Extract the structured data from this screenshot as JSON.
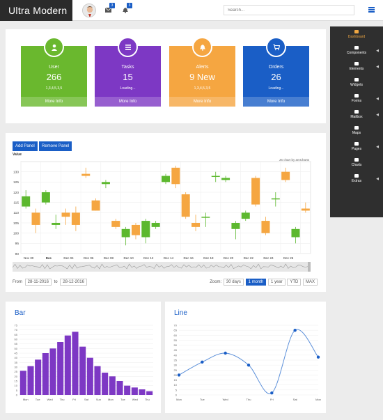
{
  "header": {
    "brand": "Ultra Modern",
    "mail_badge": "3",
    "bell_badge": "3",
    "search_placeholder": "Search..."
  },
  "sidebar": {
    "items": [
      {
        "label": "Dashboard",
        "icon": "home-icon",
        "active": true
      },
      {
        "label": "Components",
        "icon": "cogs-icon"
      },
      {
        "label": "Elements",
        "icon": "book-icon"
      },
      {
        "label": "Widgets",
        "icon": "grid-icon"
      },
      {
        "label": "Forms",
        "icon": "edit-icon"
      },
      {
        "label": "Mailbox",
        "icon": "mail-icon"
      },
      {
        "label": "Maps",
        "icon": "location-arrow-icon"
      },
      {
        "label": "Pages",
        "icon": "file-icon"
      },
      {
        "label": "Charts",
        "icon": "chart-icon"
      },
      {
        "label": "Extras",
        "icon": "list-icon"
      }
    ]
  },
  "stats": [
    {
      "label": "User",
      "value": "266",
      "sub": "1,3,4,5,3,5",
      "more": "More Info",
      "color": "#6ab82e",
      "icon": "user-icon"
    },
    {
      "label": "Tasks",
      "value": "15",
      "sub": "Loading...",
      "more": "More Info",
      "color": "#7d38c4",
      "icon": "list-icon"
    },
    {
      "label": "Alerts",
      "value": "9 New",
      "sub": "1,3,4,5,3,5",
      "more": "More Info",
      "color": "#f5a641",
      "icon": "bell-icon"
    },
    {
      "label": "Orders",
      "value": "26",
      "sub": "Loading...",
      "more": "More Info",
      "color": "#1a5ec6",
      "icon": "cart-icon"
    }
  ],
  "candle_panel": {
    "add_label": "Add Panel",
    "remove_label": "Remove Panel",
    "from_label": "From",
    "to_label": "to",
    "from_date": "28-11-2016",
    "to_date": "28-12-2016",
    "zoom_label": "Zoom:",
    "zoom_options": [
      "30 days",
      "1 month",
      "1 year",
      "YTD",
      "MAX"
    ],
    "zoom_selected": "1 month"
  },
  "chart_data": [
    {
      "type": "candlestick",
      "ylabel": "Value",
      "credit": "JS chart by amCharts",
      "ylim": [
        90,
        135
      ],
      "yticks": [
        90,
        95,
        100,
        105,
        110,
        115,
        120,
        125,
        130
      ],
      "xticks": [
        "Nov 30",
        "Dec",
        "Dec 04",
        "Dec 06",
        "Dec 08",
        "Dec 10",
        "Dec 12",
        "Dec 14",
        "Dec 16",
        "Dec 18",
        "Dec 20",
        "Dec 22",
        "Dec 24",
        "Dec 26"
      ],
      "up_color": "#5cb82e",
      "down_color": "#f5a641",
      "candles": [
        {
          "open": 113,
          "close": 118,
          "high": 121,
          "low": 112
        },
        {
          "open": 110,
          "close": 104,
          "high": 112,
          "low": 100
        },
        {
          "open": 115,
          "close": 120,
          "high": 121,
          "low": 114
        },
        {
          "open": 104,
          "close": 105,
          "high": 109,
          "low": 102
        },
        {
          "open": 110,
          "close": 108,
          "high": 112,
          "low": 104
        },
        {
          "open": 110,
          "close": 104,
          "high": 113,
          "low": 101
        },
        {
          "open": 129,
          "close": 128,
          "high": 132,
          "low": 127
        },
        {
          "open": 116,
          "close": 111,
          "high": 117,
          "low": 111
        },
        {
          "open": 124,
          "close": 125,
          "high": 126,
          "low": 122
        },
        {
          "open": 106,
          "close": 103,
          "high": 107,
          "low": 102
        },
        {
          "open": 98,
          "close": 102,
          "high": 103,
          "low": 94
        },
        {
          "open": 104,
          "close": 99,
          "high": 105,
          "low": 97
        },
        {
          "open": 98,
          "close": 106,
          "high": 107,
          "low": 95
        },
        {
          "open": 103,
          "close": 105,
          "high": 106,
          "low": 102
        },
        {
          "open": 125,
          "close": 128,
          "high": 129,
          "low": 124
        },
        {
          "open": 132,
          "close": 124,
          "high": 133,
          "low": 122
        },
        {
          "open": 119,
          "close": 108,
          "high": 120,
          "low": 107
        },
        {
          "open": 105,
          "close": 103,
          "high": 109,
          "low": 101
        },
        {
          "open": 108,
          "close": 108,
          "high": 110,
          "low": 103
        },
        {
          "open": 128,
          "close": 128,
          "high": 130,
          "low": 125
        },
        {
          "open": 126,
          "close": 127,
          "high": 128,
          "low": 125
        },
        {
          "open": 102,
          "close": 105,
          "high": 106,
          "low": 97
        },
        {
          "open": 107,
          "close": 110,
          "high": 111,
          "low": 106
        },
        {
          "open": 127,
          "close": 114,
          "high": 128,
          "low": 113
        },
        {
          "open": 106,
          "close": 100,
          "high": 108,
          "low": 99
        },
        {
          "open": 117,
          "close": 117,
          "high": 120,
          "low": 113
        },
        {
          "open": 130,
          "close": 126,
          "high": 132,
          "low": 125
        },
        {
          "open": 98,
          "close": 102,
          "high": 103,
          "low": 95
        },
        {
          "open": 112,
          "close": 111,
          "high": 115,
          "low": 110
        }
      ]
    },
    {
      "type": "bar",
      "title": "Bar",
      "color": "#7d38c4",
      "ylim": [
        0,
        75
      ],
      "yticks": [
        0,
        5,
        10,
        15,
        20,
        25,
        30,
        35,
        40,
        45,
        50,
        55,
        60,
        65,
        70,
        75
      ],
      "xticks": [
        "Mon",
        "Tue",
        "Wed",
        "Thu",
        "Fri",
        "Sat",
        "Sun",
        "Mon",
        "Tue",
        "Wed",
        "Thu"
      ],
      "values": [
        26,
        31,
        38,
        45,
        50,
        57,
        64,
        68,
        52,
        40,
        31,
        24,
        20,
        15,
        10,
        8,
        6,
        4
      ]
    },
    {
      "type": "line",
      "title": "Line",
      "color": "#1a5ec6",
      "ylim": [
        0,
        70
      ],
      "yticks": [
        0,
        5,
        10,
        15,
        20,
        25,
        30,
        35,
        40,
        45,
        50,
        55,
        60,
        65,
        70
      ],
      "categories": [
        "Mon",
        "Tue",
        "Wed",
        "Thu",
        "Fri",
        "Sat",
        "Mon"
      ],
      "values": [
        20,
        33,
        42,
        30,
        2,
        65,
        38
      ]
    }
  ]
}
